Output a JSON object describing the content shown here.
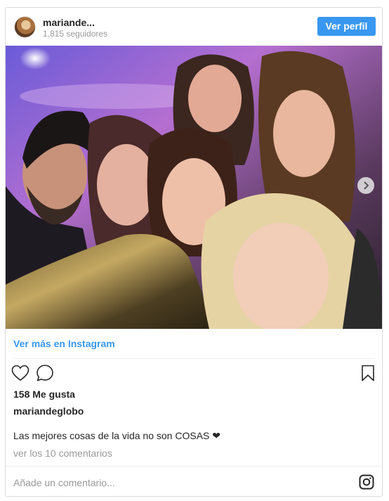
{
  "header": {
    "username": "mariande...",
    "followers": "1,815 seguidores",
    "profile_button": "Ver perfil"
  },
  "post": {
    "view_more_link": "Ver más en Instagram",
    "likes": "158 Me gusta",
    "author": "mariandeglobo",
    "caption": "Las mejores cosas de la vida no son COSAS ❤",
    "view_comments": "ver los 10 comentarios",
    "comment_placeholder": "Añade un comentario..."
  },
  "icons": {
    "like": "heart-icon",
    "comment": "comment-bubble-icon",
    "save": "bookmark-icon",
    "next": "chevron-right-icon",
    "brand": "instagram-icon"
  },
  "colors": {
    "accent": "#3897f0",
    "text": "#262626",
    "muted": "#999999",
    "border": "#dbdbdb"
  }
}
